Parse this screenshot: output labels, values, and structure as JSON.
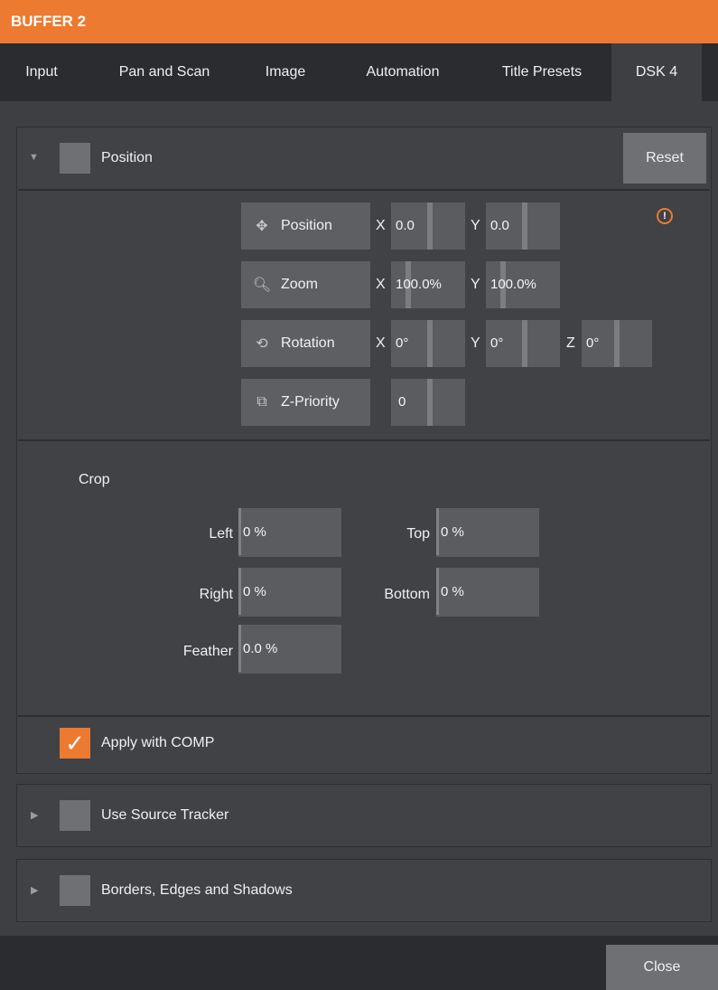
{
  "window": {
    "title": "BUFFER 2"
  },
  "tabs": [
    {
      "label": "Input"
    },
    {
      "label": "Pan and Scan"
    },
    {
      "label": "Image"
    },
    {
      "label": "Automation"
    },
    {
      "label": "Title Presets"
    },
    {
      "label": "DSK 4",
      "active": true
    }
  ],
  "position_section": {
    "label": "Position",
    "reset_label": "Reset",
    "info_glyph": "!",
    "rows": {
      "position": {
        "label": "Position",
        "icon": "move-arrows-icon",
        "x_axis": "X",
        "x_value": "0.0",
        "y_axis": "Y",
        "y_value": "0.0"
      },
      "zoom": {
        "label": "Zoom",
        "icon": "magnifier-icon",
        "x_axis": "X",
        "x_value": "100.0%",
        "y_axis": "Y",
        "y_value": "100.0%"
      },
      "rotation": {
        "label": "Rotation",
        "icon": "rotate-icon",
        "x_axis": "X",
        "x_value": "0°",
        "y_axis": "Y",
        "y_value": "0°",
        "z_axis": "Z",
        "z_value": "0°"
      },
      "zpriority": {
        "label": "Z-Priority",
        "icon": "layers-icon",
        "value": "0"
      }
    }
  },
  "crop": {
    "label": "Crop",
    "left": {
      "label": "Left",
      "value": "0 %"
    },
    "top": {
      "label": "Top",
      "value": "0 %"
    },
    "right": {
      "label": "Right",
      "value": "0 %"
    },
    "bottom": {
      "label": "Bottom",
      "value": "0 %"
    },
    "feather": {
      "label": "Feather",
      "value": "0.0 %"
    }
  },
  "apply_with_comp": {
    "label": "Apply with COMP",
    "checked": true
  },
  "source_tracker": {
    "label": "Use Source Tracker"
  },
  "borders": {
    "label": "Borders, Edges and Shadows"
  },
  "footer": {
    "close_label": "Close"
  },
  "colors": {
    "accent": "#ec7a30",
    "background": "#3d3f42",
    "tabbar": "#2a2c30",
    "field": "#5a5c60"
  }
}
